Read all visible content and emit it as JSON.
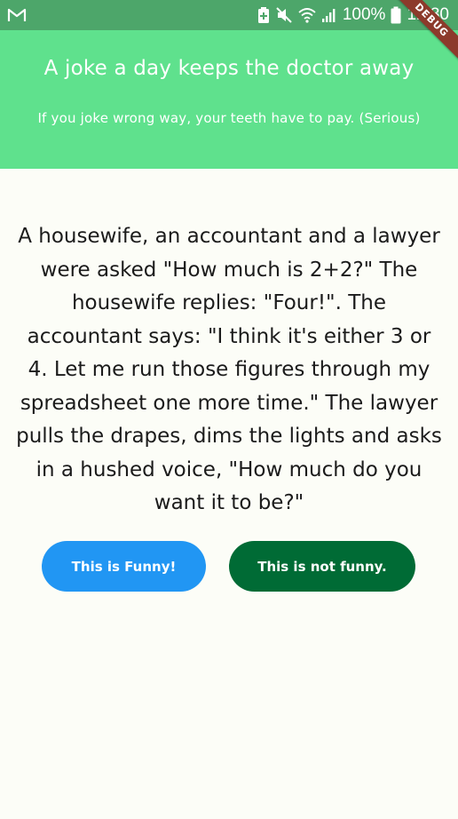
{
  "status_bar": {
    "battery_percent": "100%",
    "time": "12:30",
    "icons": [
      "gmail-icon",
      "battery-saver-icon",
      "mute-icon",
      "wifi-icon",
      "signal-icon",
      "battery-icon"
    ]
  },
  "debug_banner": "DEBUG",
  "header": {
    "title": "A joke a day keeps the doctor away",
    "subtitle": "If you joke wrong way, your teeth have to pay. (Serious)",
    "background_color": "#5fe18d"
  },
  "joke": {
    "text": "A housewife, an accountant and a lawyer were asked \"How much is 2+2?\" The housewife replies: \"Four!\". The accountant says: \"I think it's either 3 or 4. Let me run those figures through my spreadsheet one more time.\" The lawyer pulls the drapes, dims the lights and asks in a hushed voice, \"How much do you want it to be?\""
  },
  "buttons": {
    "funny_label": "This is Funny!",
    "funny_color": "#2196f3",
    "not_funny_label": "This is not funny.",
    "not_funny_color": "#006b35"
  }
}
